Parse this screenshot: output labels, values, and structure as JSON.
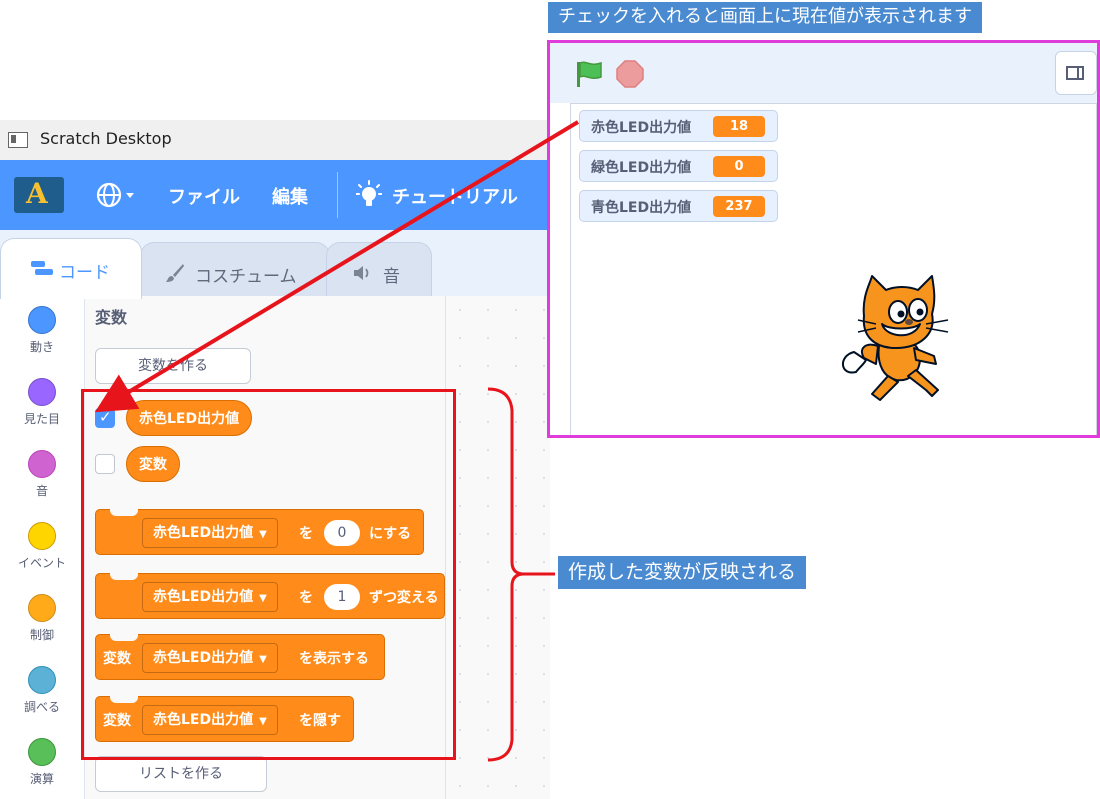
{
  "window": {
    "title": "Scratch Desktop"
  },
  "menubar": {
    "file": "ファイル",
    "edit": "編集",
    "tutorial": "チュートリアル"
  },
  "tabs": [
    {
      "label": "コード",
      "icon": "code-blocks-icon",
      "active": true
    },
    {
      "label": "コスチューム",
      "icon": "paintbrush-icon",
      "active": false
    },
    {
      "label": "音",
      "icon": "speaker-icon",
      "active": false
    }
  ],
  "categories": [
    {
      "label": "動き",
      "color": "#4c97ff"
    },
    {
      "label": "見た目",
      "color": "#9966ff"
    },
    {
      "label": "音",
      "color": "#cf63cf"
    },
    {
      "label": "イベント",
      "color": "#ffd500"
    },
    {
      "label": "制御",
      "color": "#ffab19"
    },
    {
      "label": "調べる",
      "color": "#5cb1d6"
    },
    {
      "label": "演算",
      "color": "#59c059"
    }
  ],
  "palette": {
    "section_title": "変数",
    "make_variable": "変数を作る",
    "make_list": "リストを作る",
    "variables": [
      {
        "name": "赤色LED出力値",
        "checked": true
      },
      {
        "name": "変数",
        "checked": false
      }
    ],
    "blocks": [
      {
        "dropdown": "赤色LED出力値",
        "word1": "を",
        "value": "0",
        "word2": "にする"
      },
      {
        "dropdown": "赤色LED出力値",
        "word1": "を",
        "value": "1",
        "word2": "ずつ変える"
      },
      {
        "prefix": "変数",
        "dropdown": "赤色LED出力値",
        "word1": "を表示する"
      },
      {
        "prefix": "変数",
        "dropdown": "赤色LED出力値",
        "word1": "を隠す"
      }
    ]
  },
  "stage": {
    "monitors": [
      {
        "name": "赤色LED出力値",
        "value": "18"
      },
      {
        "name": "緑色LED出力値",
        "value": "0"
      },
      {
        "name": "青色LED出力値",
        "value": "237"
      }
    ]
  },
  "annotations": {
    "top_note": "チェックを入れると画面上に現在値が表示されます",
    "side_note": "作成した変数が反映される",
    "highlight_color": "#e8141c",
    "stage_border_color": "#e03cdc"
  },
  "colors": {
    "accent": "#4c97ff",
    "variables": "#ff8c1a",
    "callout": "#4a8ad0"
  }
}
